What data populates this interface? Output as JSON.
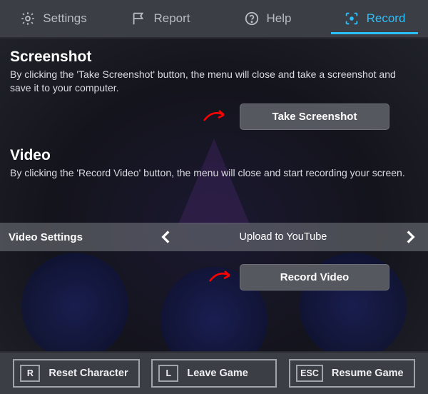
{
  "tabs": {
    "settings": "Settings",
    "report": "Report",
    "help": "Help",
    "record": "Record"
  },
  "screenshot": {
    "heading": "Screenshot",
    "desc": "By clicking the 'Take Screenshot' button, the menu will close and take a screenshot and save it to your computer.",
    "button": "Take Screenshot"
  },
  "video": {
    "heading": "Video",
    "desc": "By clicking the 'Record Video' button, the menu will close and start recording your screen.",
    "settings_label": "Video Settings",
    "option": "Upload to YouTube",
    "button": "Record Video"
  },
  "footer": {
    "reset": {
      "key": "R",
      "label": "Reset Character"
    },
    "leave": {
      "key": "L",
      "label": "Leave Game"
    },
    "resume": {
      "key": "ESC",
      "label": "Resume Game"
    }
  },
  "colors": {
    "accent": "#28c0ff",
    "annotation": "#ff0000"
  }
}
